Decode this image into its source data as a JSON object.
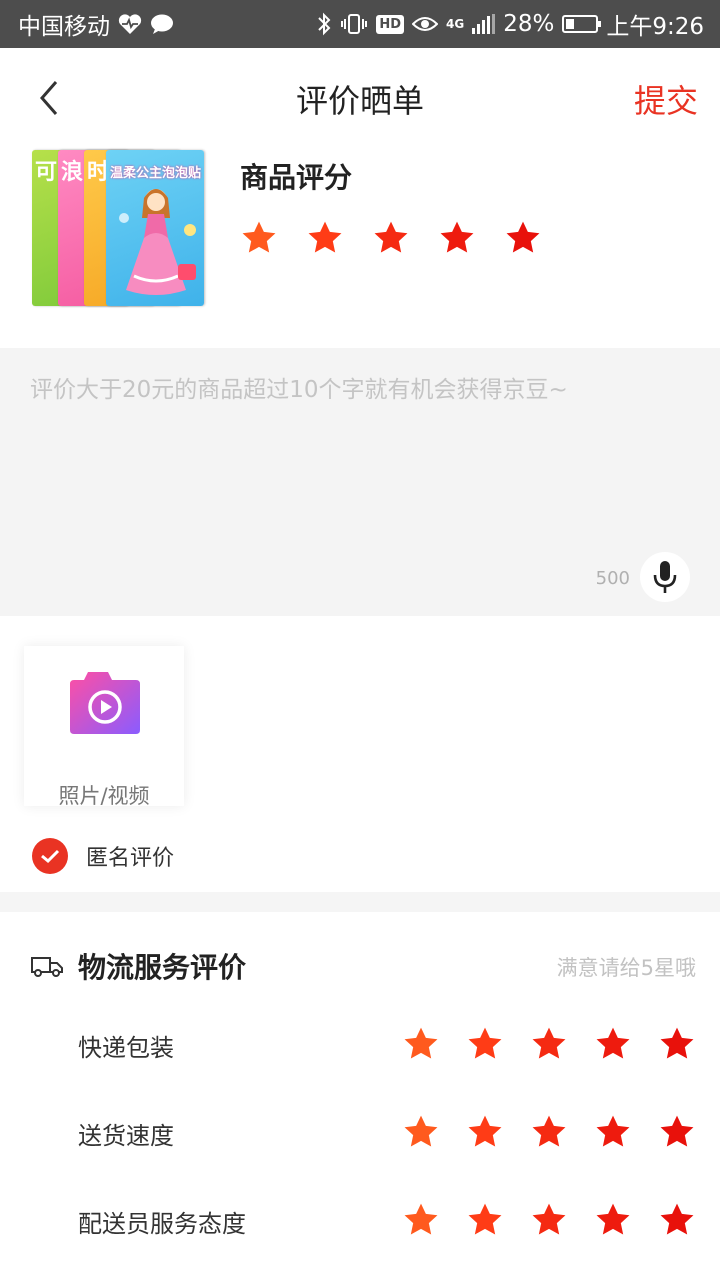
{
  "status_bar": {
    "carrier": "中国移动",
    "battery": "28%",
    "battery_level": 0.28,
    "time": "上午9:26",
    "network": "4G",
    "icons": [
      "heart-pulse-icon",
      "chat-bubble-icon",
      "bluetooth-icon",
      "vibrate-icon",
      "hd-icon",
      "eye-icon",
      "signal-icon",
      "battery-icon"
    ]
  },
  "header": {
    "title": "评价晒单",
    "submit_label": "提交",
    "back_icon": "chevron-left-icon"
  },
  "product": {
    "rating_label": "商品评分",
    "rating": 5,
    "max_rating": 5,
    "cover_title": "温柔公主泡泡贴",
    "spine_titles": [
      "可",
      "浪",
      "时"
    ]
  },
  "review": {
    "placeholder": "评价大于20元的商品超过10个字就有机会获得京豆~",
    "value": "",
    "char_limit": "500",
    "mic_icon": "microphone-icon"
  },
  "media": {
    "upload_label": "照片/视频",
    "upload_icon": "camera-video-icon"
  },
  "anonymous": {
    "label": "匿名评价",
    "checked": true
  },
  "logistics": {
    "title": "物流服务评价",
    "hint": "满意请给5星哦",
    "icon": "truck-icon",
    "items": [
      {
        "label": "快递包装",
        "rating": 5
      },
      {
        "label": "送货速度",
        "rating": 5
      },
      {
        "label": "配送员服务态度",
        "rating": 5
      }
    ]
  },
  "colors": {
    "accent": "#e93323",
    "star_gradient": [
      "#ff5a1e",
      "#ff3c16",
      "#f52a12",
      "#ee1b0e",
      "#e8110b"
    ]
  }
}
